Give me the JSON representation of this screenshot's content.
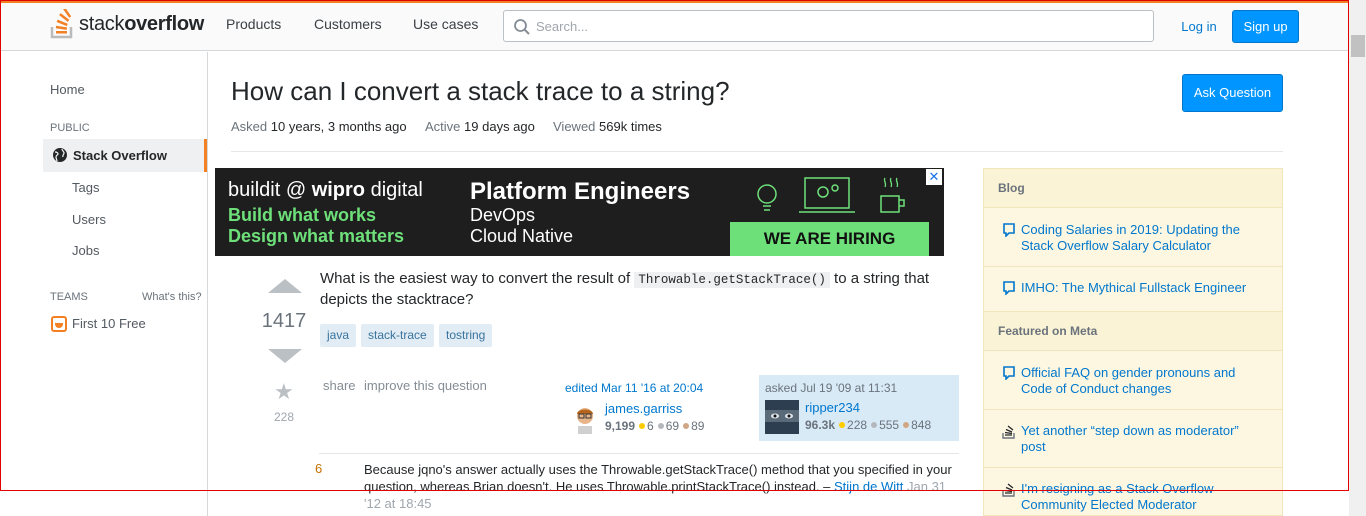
{
  "header": {
    "logo_light": "stack",
    "logo_bold": "overflow",
    "nav": [
      "Products",
      "Customers",
      "Use cases"
    ],
    "search_placeholder": "Search...",
    "login_label": "Log in",
    "signup_label": "Sign up"
  },
  "sidebar": {
    "home": "Home",
    "public_label": "PUBLIC",
    "active_item": "Stack Overflow",
    "sub_items": [
      "Tags",
      "Users",
      "Jobs"
    ],
    "teams_label": "TEAMS",
    "whats_this": "What's this?",
    "first_free": "First 10 Free"
  },
  "question": {
    "title": "How can I convert a stack trace to a string?",
    "asked_label": "Asked",
    "asked_value": "10 years, 3 months ago",
    "active_label": "Active",
    "active_value": "19 days ago",
    "viewed_label": "Viewed",
    "viewed_value": "569k times",
    "ask_button": "Ask Question",
    "votes": "1417",
    "favorites": "228",
    "body_before": "What is the easiest way to convert the result of",
    "body_code": "Throwable.getStackTrace()",
    "body_after": "to a string that depicts the stacktrace?",
    "tags": [
      "java",
      "stack-trace",
      "tostring"
    ],
    "share": "share",
    "improve": "improve this question",
    "edited_label": "edited Mar 11 '16 at 20:04",
    "editor": {
      "name": "james.garriss",
      "rep": "9,199",
      "gold": "6",
      "silver": "69",
      "bronze": "89"
    },
    "asked_box_label": "asked Jul 19 '09 at 11:31",
    "asker": {
      "name": "ripper234",
      "rep": "96.3k",
      "gold": "228",
      "silver": "555",
      "bronze": "848"
    }
  },
  "comment": {
    "score": "6",
    "text": "Because jqno's answer actually uses the Throwable.getStackTrace() method that you specified in your question, whereas Brian doesn't. He uses Throwable.printStackTrace() instead. –",
    "user": "Stijn de Witt",
    "date": "Jan 31 '12 at 18:45"
  },
  "ad": {
    "buildit": "buildit @",
    "wipro": "wipro",
    "digital": "digital",
    "line1": "Build what works",
    "line2": "Design what matters",
    "headline": "Platform Engineers",
    "sub1": "DevOps",
    "sub2": "Cloud Native",
    "hiring": "WE ARE HIRING",
    "close": "✕"
  },
  "right_sidebar": {
    "blog_heading": "Blog",
    "blog_items": [
      "Coding Salaries in 2019: Updating the Stack Overflow Salary Calculator",
      "IMHO: The Mythical Fullstack Engineer"
    ],
    "meta_heading": "Featured on Meta",
    "meta_items": [
      "Official FAQ on gender pronouns and Code of Conduct changes",
      "Yet another “step down as moderator” post",
      "I'm resigning as a Stack Overflow Community Elected Moderator"
    ]
  },
  "colors": {
    "accent": "#f48024",
    "link": "#0077cc",
    "button": "#0095ff",
    "ad_green": "#6ee07a",
    "gold": "#ffcc01",
    "silver": "#b4b8bc",
    "bronze": "#d1a684"
  }
}
